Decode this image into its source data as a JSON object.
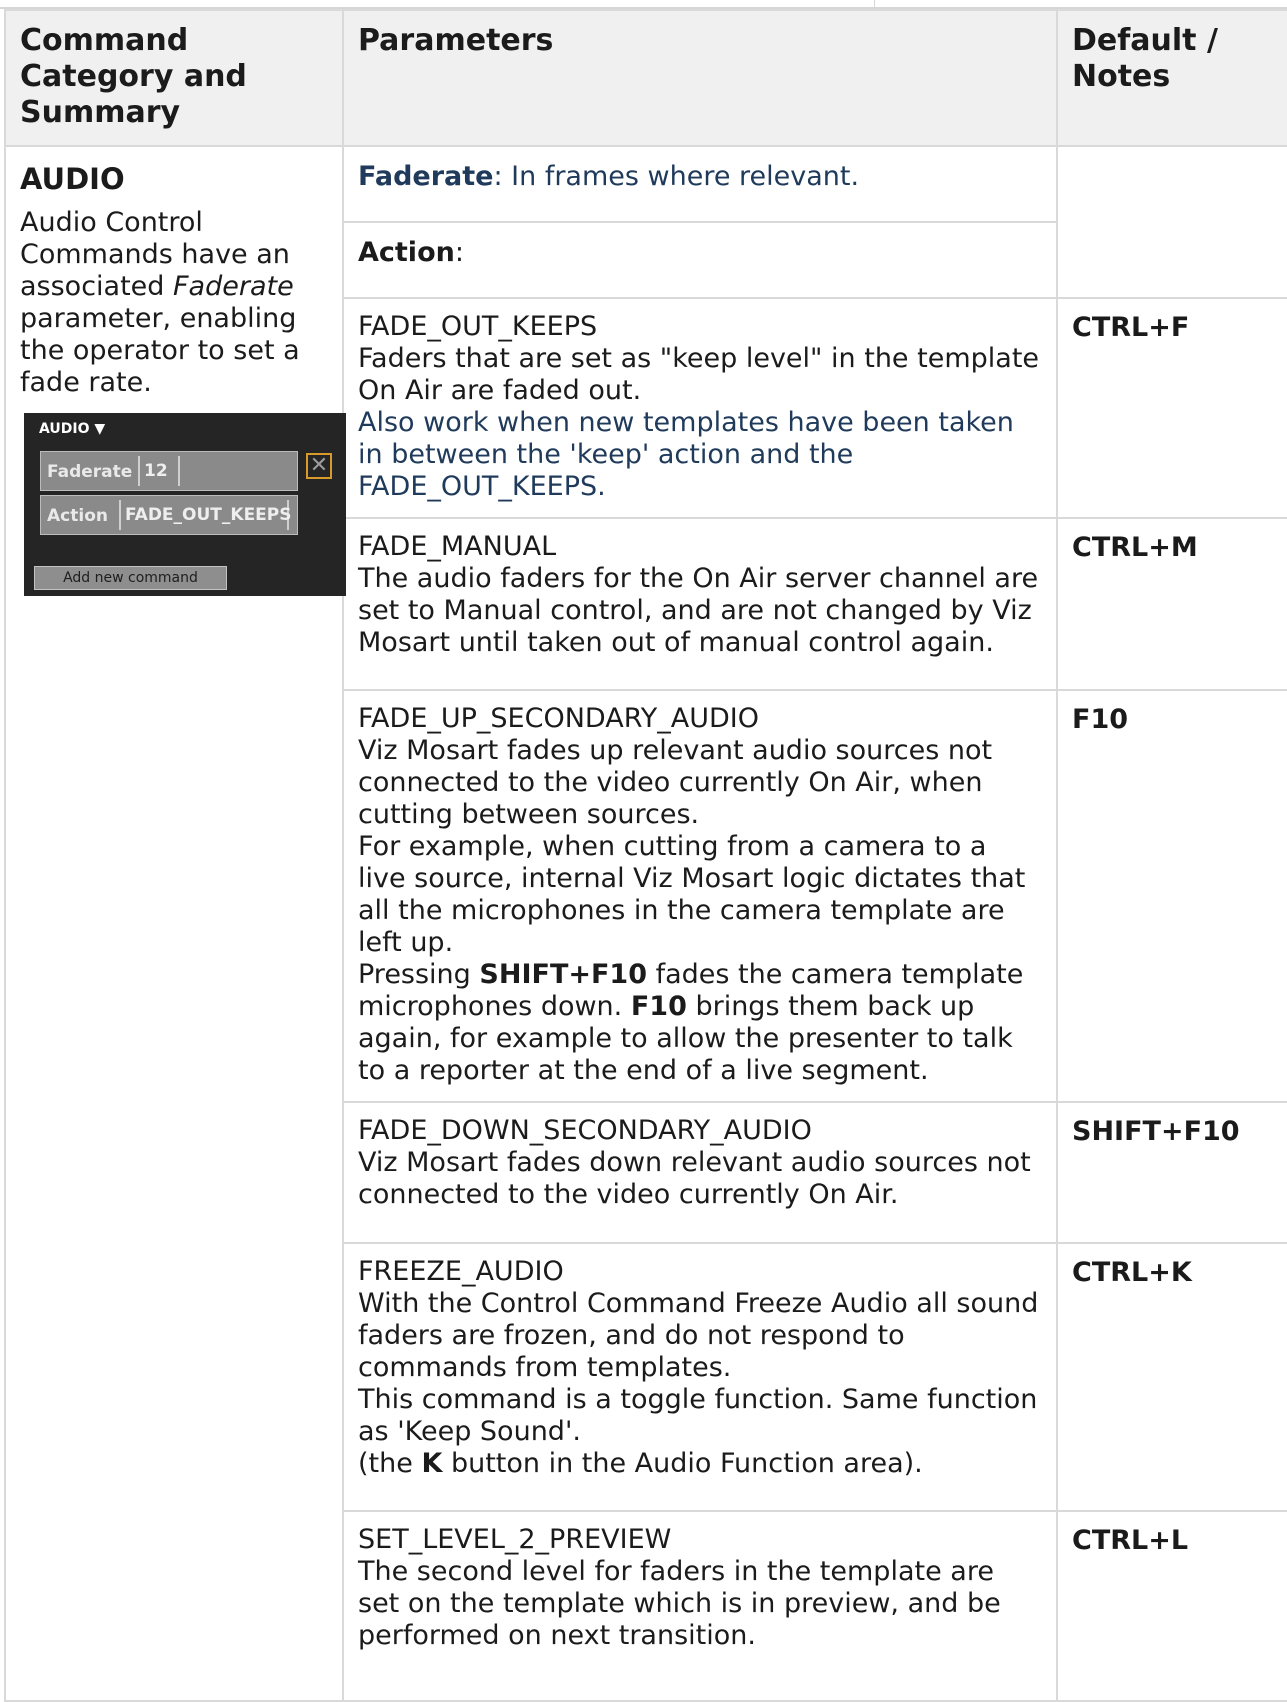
{
  "header": {
    "col1": "Command Category and Summary",
    "col2": "Parameters",
    "col3": "Default / Notes"
  },
  "category": {
    "title": "AUDIO",
    "desc_a": "Audio Control Commands have an associated ",
    "desc_italic": "Faderate",
    "desc_b": " parameter, enabling the operator to set a fade rate."
  },
  "panel": {
    "title": "AUDIO ▼",
    "faderate_label": "Faderate",
    "faderate_value": "12",
    "action_label": "Action",
    "action_value": "FADE_OUT_KEEPS",
    "close_icon": "✕",
    "add_button": "Add new command"
  },
  "params": {
    "faderate_label": "Faderate",
    "faderate_text": ": In frames where relevant.",
    "action_label": "Action",
    "action_colon": ":"
  },
  "rows": [
    {
      "name": "FADE_OUT_KEEPS",
      "text": "Faders that are set as \"keep level\" in the template On Air are faded out.",
      "note": "Also work when new templates have been taken in between the 'keep' action and the FADE_OUT_KEEPS.",
      "key": "CTRL+F"
    },
    {
      "name": "FADE_MANUAL",
      "text": "The audio faders for the On Air server channel are set to Manual control, and are not changed by Viz Mosart until taken out of manual control again.",
      "key": "CTRL+M"
    },
    {
      "name": "FADE_UP_SECONDARY_AUDIO",
      "text": "Viz Mosart fades up relevant audio sources not connected to the video currently On Air, when cutting between sources.",
      "text2": "For example, when cutting from a camera to a live source, internal Viz Mosart logic dictates that all the microphones in the camera template are left up.",
      "p3a": "Pressing ",
      "p3b": "SHIFT+F10",
      "p3c": " fades the camera template microphones down. ",
      "p3d": "F10",
      "p3e": " brings them back up again, for example to allow the presenter to talk to a reporter at the end of a live segment.",
      "key": "F10"
    },
    {
      "name": "FADE_DOWN_SECONDARY_AUDIO",
      "text": "Viz Mosart fades down relevant audio sources not connected to the video currently On Air.",
      "key": "SHIFT+F10"
    },
    {
      "name": "FREEZE_AUDIO",
      "text": "With the Control Command Freeze Audio all sound faders are frozen, and do not respond to commands from templates.",
      "text2": "This command is a toggle function. Same function as 'Keep Sound'.",
      "p3a": "(the ",
      "p3b": "K",
      "p3c": " button in the Audio Function area).",
      "key": "CTRL+K"
    },
    {
      "name": "SET_LEVEL_2_PREVIEW",
      "text": "The second level for faders in the template are set on the template which is in preview, and be performed on next transition.",
      "key": "CTRL+L"
    }
  ]
}
